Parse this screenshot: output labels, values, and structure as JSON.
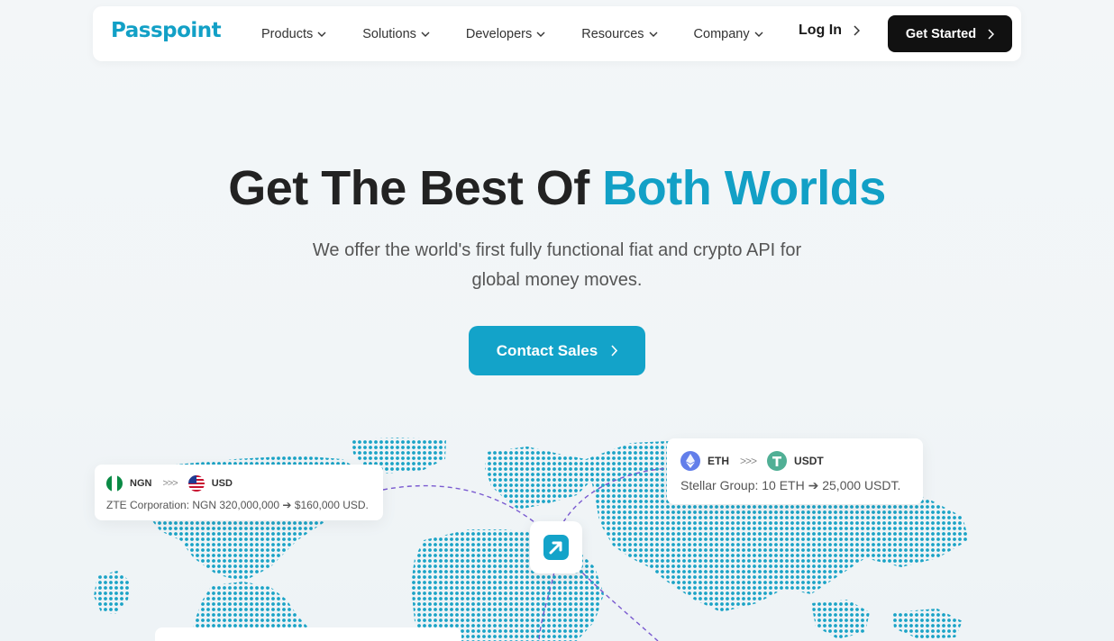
{
  "brand": {
    "name": "Passpoint"
  },
  "nav": {
    "items": [
      {
        "label": "Products"
      },
      {
        "label": "Solutions"
      },
      {
        "label": "Developers"
      },
      {
        "label": "Resources"
      },
      {
        "label": "Company"
      }
    ],
    "login_label": "Log In",
    "cta_label": "Get Started"
  },
  "hero": {
    "title_main": "Get The Best Of ",
    "title_accent": "Both Worlds",
    "subtitle_line1": "We offer the world's first fully functional fiat and crypto API for",
    "subtitle_line2": "global money moves.",
    "cta_label": "Contact Sales"
  },
  "cards": {
    "fiat": {
      "from_code": "NGN",
      "to_code": "USD",
      "arrows": ">>>",
      "description": "ZTE Corporation: NGN 320,000,000 ➔ $160,000 USD."
    },
    "crypto": {
      "from_code": "ETH",
      "to_code": "USDT",
      "arrows": ">>>",
      "description": "Stellar Group:  10 ETH ➔ 25,000 USDT."
    }
  },
  "colors": {
    "accent": "#13a3c9",
    "dark": "#111111",
    "map_dot": "#1aa3c6"
  },
  "icons": {
    "badge": "arrow-up-right-icon"
  }
}
